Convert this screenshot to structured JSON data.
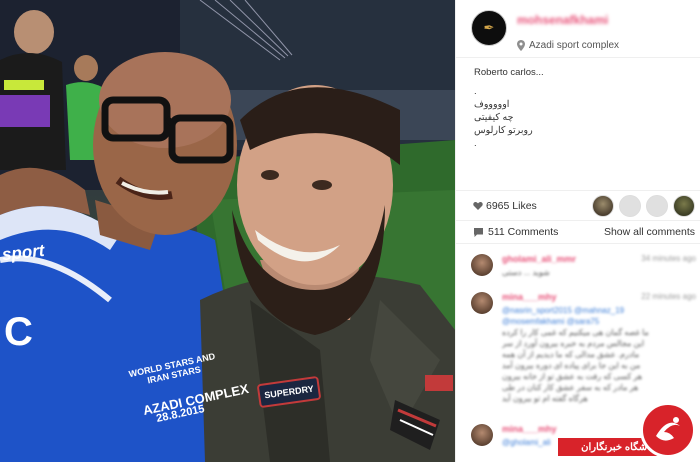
{
  "post": {
    "username": "mohsenafkhami",
    "location": "Azadi sport complex",
    "caption_lines": [
      "Roberto carlos...",
      ".",
      "اوووووف",
      "چه کیفیتی",
      "روبرتو کارلوس",
      "."
    ],
    "likes": "6965 Likes",
    "comments_count": "511 Comments",
    "show_all": "Show all comments"
  },
  "photo": {
    "jersey_brand": "sport",
    "jersey_event": "WORLD STARS AND IRAN STARS",
    "jersey_venue": "AZADI COMPLEX",
    "jersey_date": "28.8.2015",
    "patch_text": "SUPERDRY",
    "jersey_letter": "C"
  },
  "comments": [
    {
      "name": "gholami_ali_mmr",
      "time": "34 minutes ago",
      "lines": [
        "شوید ... دستی"
      ]
    },
    {
      "name": "mina___mhy",
      "time": "22 minutes ago",
      "lines": [
        {
          "text": "@nasrin_sport2015 @mahnaz_19",
          "link": true
        },
        {
          "text": "@mosemfakhami @sara75",
          "link": true
        },
        {
          "text": "ما غصه گمان هی میکنیم که غمی کار را کرده",
          "link": false
        },
        {
          "text": "این مجالس مردم به خبره بیرون آورد از سر",
          "link": false
        },
        {
          "text": "مادرم. عشق مدالی که ما دیدیم از آن همه",
          "link": false
        },
        {
          "text": "من به این جا برای پیاده ای دوره بیرون آمد",
          "link": false
        },
        {
          "text": "هر کسی که رفت به عشق تو از خانه بیرون",
          "link": false
        },
        {
          "text": "هر مادر که به سفر عشق کار کنان در طی",
          "link": false
        },
        {
          "text": "هرگاه گفته ام تو بیرون آید",
          "link": false
        }
      ]
    },
    {
      "name": "mina___mhy",
      "time": "22 minutes ago",
      "lines": [
        {
          "text": "@gholami_ali",
          "link": true
        }
      ]
    }
  ],
  "watermark": {
    "text": "باشگاه خبرنگاران"
  },
  "colors": {
    "username_pink": "#e8537a",
    "link_blue": "#3b7dd8",
    "watermark_red": "#d8232a"
  }
}
